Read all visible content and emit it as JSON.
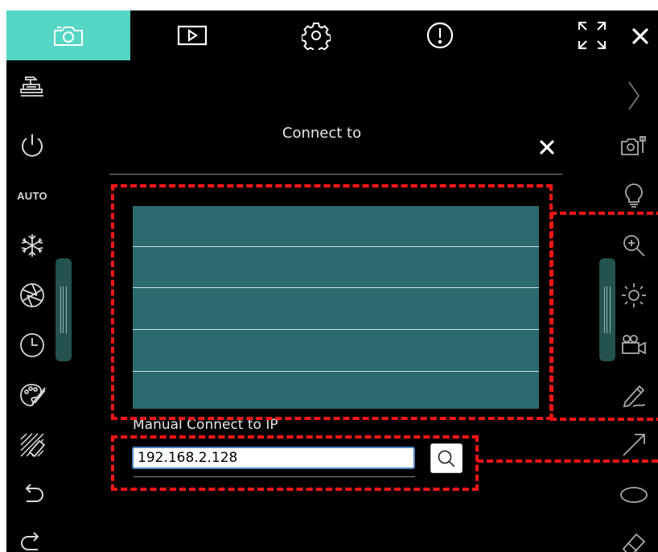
{
  "window": {
    "tabs": [
      {
        "icon": "camera-icon",
        "active": true
      },
      {
        "icon": "play-icon",
        "active": false
      },
      {
        "icon": "gear-icon",
        "active": false
      },
      {
        "icon": "info-icon",
        "active": false
      }
    ],
    "controls": [
      "fullscreen-icon",
      "close-icon"
    ]
  },
  "left_toolbar": {
    "items": [
      {
        "icon": "visualizer-icon"
      },
      {
        "icon": "power-icon"
      },
      {
        "icon": "auto-label",
        "label": "AUTO"
      },
      {
        "icon": "freeze-icon"
      },
      {
        "icon": "aperture-icon"
      },
      {
        "icon": "timer-icon"
      },
      {
        "icon": "palette-icon"
      },
      {
        "icon": "mask-icon"
      },
      {
        "icon": "undo-icon"
      },
      {
        "icon": "redo-icon"
      }
    ]
  },
  "right_toolbar": {
    "items": [
      {
        "icon": "chevron-right-icon"
      },
      {
        "icon": "camera-settings-icon"
      },
      {
        "icon": "lamp-icon"
      },
      {
        "icon": "zoom-in-icon"
      },
      {
        "icon": "brightness-icon"
      },
      {
        "icon": "video-record-icon"
      },
      {
        "icon": "pen-icon"
      },
      {
        "icon": "arrow-icon"
      },
      {
        "icon": "ellipse-icon"
      },
      {
        "icon": "eraser-icon"
      }
    ]
  },
  "dialog": {
    "title": "Connect to",
    "device_list": {
      "rows": 5,
      "background": "#2b6a6e"
    },
    "manual_label": "Manual Connect to IP",
    "ip_value": "192.168.2.128"
  },
  "colors": {
    "accent": "#55d6c4",
    "background": "#000000",
    "highlight": "#ff1515",
    "list": "#2b6a6e"
  }
}
